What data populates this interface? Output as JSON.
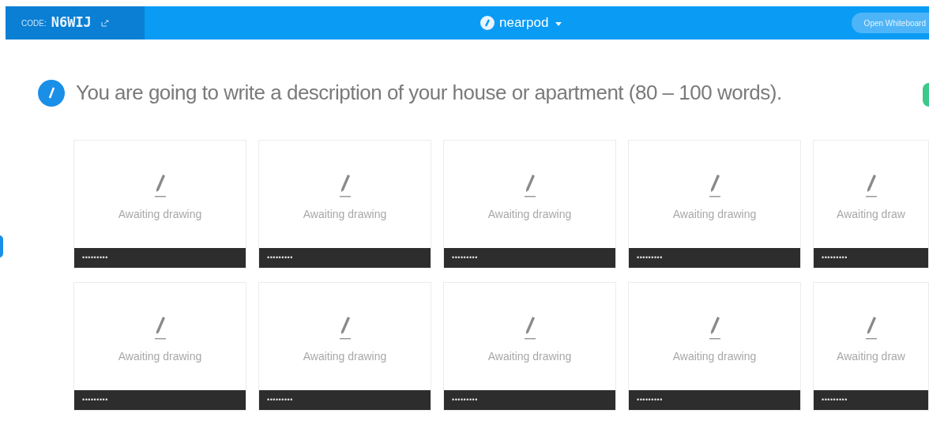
{
  "top_bar": {
    "code_label": "CODE:",
    "code": "N6WIJ",
    "logo_text": "nearpod",
    "button": "Open Whiteboard"
  },
  "prompt": "You are going to write a description of your house or apartment (80 – 100 words).",
  "cards": [
    {
      "status": "Awaiting drawing",
      "student": "•••••••••"
    },
    {
      "status": "Awaiting drawing",
      "student": "•••••••••"
    },
    {
      "status": "Awaiting drawing",
      "student": "•••••••••"
    },
    {
      "status": "Awaiting drawing",
      "student": "•••••••••"
    },
    {
      "status": "Awaiting draw",
      "student": "•••••••••"
    },
    {
      "status": "Awaiting drawing",
      "student": "•••••••••"
    },
    {
      "status": "Awaiting drawing",
      "student": "•••••••••"
    },
    {
      "status": "Awaiting drawing",
      "student": "•••••••••"
    },
    {
      "status": "Awaiting drawing",
      "student": "•••••••••"
    },
    {
      "status": "Awaiting draw",
      "student": "•••••••••"
    }
  ]
}
